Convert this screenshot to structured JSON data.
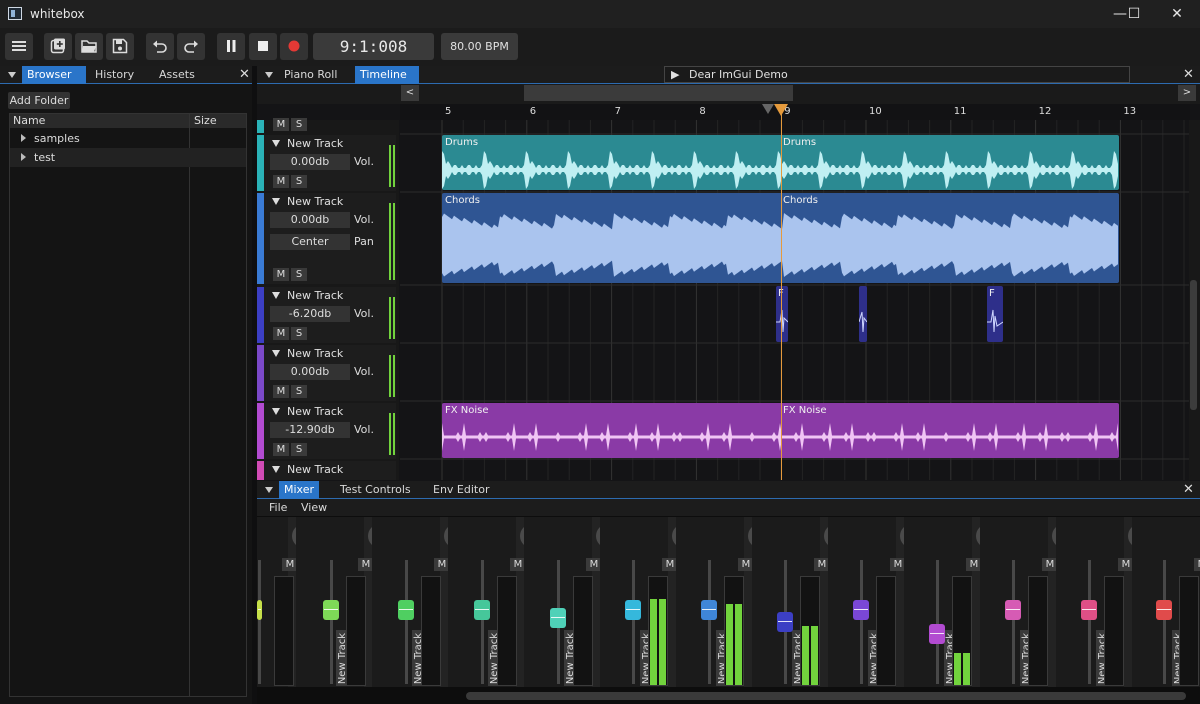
{
  "window": {
    "title": "whitebox",
    "minimize": "—",
    "maximize": "☐",
    "close": "✕"
  },
  "toolbar": {
    "buttons": [
      "menu-icon",
      "new-file-icon",
      "open-folder-icon",
      "save-icon",
      "undo-icon",
      "redo-icon",
      "pause-icon",
      "stop-icon",
      "record-icon"
    ],
    "time": "9:1:008",
    "bpm": "80.00 BPM"
  },
  "left_panel": {
    "tabs": [
      "Browser",
      "History",
      "Assets"
    ],
    "add_folder": "Add Folder",
    "columns": [
      "Name",
      "Size"
    ],
    "rows": [
      {
        "name": "samples"
      },
      {
        "name": "test"
      }
    ]
  },
  "center_tabs": [
    "Piano Roll",
    "Timeline"
  ],
  "imgui_window": {
    "title": "Dear ImGui Demo"
  },
  "timeline": {
    "nav_left": "<",
    "nav_right": ">",
    "bars": [
      "5",
      "6",
      "7",
      "8",
      "9",
      "10",
      "11",
      "12",
      "13"
    ],
    "tracks": [
      {
        "name": "New Track",
        "volume": "0.00db",
        "vol_label": "Vol.",
        "color": "#2bb3b8"
      },
      {
        "name": "New Track",
        "volume": "0.00db",
        "vol_label": "Vol.",
        "pan": "Center",
        "pan_label": "Pan",
        "color": "#3a7bd5"
      },
      {
        "name": "New Track",
        "volume": "-6.20db",
        "vol_label": "Vol.",
        "color": "#3c3fc4"
      },
      {
        "name": "New Track",
        "volume": "0.00db",
        "vol_label": "Vol.",
        "color": "#7b49c9"
      },
      {
        "name": "New Track",
        "volume": "-12.90db",
        "vol_label": "Vol.",
        "color": "#b24bd1"
      },
      {
        "name": "New Track",
        "color": "#d14bb5"
      }
    ],
    "mute_label": "M",
    "solo_label": "S",
    "clips": {
      "drums": [
        "Drums",
        "Drums"
      ],
      "chords": [
        "Chords",
        "Chords"
      ],
      "fx": [
        "FX Noise",
        "FX Noise"
      ],
      "short": [
        "F",
        "F"
      ]
    },
    "colors": {
      "drums": "#2b8a92",
      "chords": "#2f5593",
      "fx": "#8a3aa6",
      "short": "#2e2f8a",
      "playhead": "#e59a3c"
    }
  },
  "bottom_panel": {
    "tabs": [
      "Mixer",
      "Test Controls",
      "Env Editor"
    ],
    "menu": [
      "File",
      "View"
    ]
  },
  "mixer": {
    "strip_label": "New Track",
    "mute_label": "M",
    "solo_label": "S",
    "strips": [
      {
        "color": "#c6e04a",
        "level": 0.0
      },
      {
        "color": "#7ed957",
        "level": 0.0
      },
      {
        "color": "#4fcf61",
        "level": 0.0
      },
      {
        "color": "#46c79a",
        "level": 0.0
      },
      {
        "color": "#4fd1b8",
        "level": 0.0
      },
      {
        "color": "#35b8dc",
        "level": 0.8
      },
      {
        "color": "#3f86d8",
        "level": 0.75
      },
      {
        "color": "#3c3fc4",
        "level": 0.55
      },
      {
        "color": "#7a47d6",
        "level": 0.0
      },
      {
        "color": "#b24bd1",
        "level": 0.3
      },
      {
        "color": "#d65bb4",
        "level": 0.0
      },
      {
        "color": "#df4f86",
        "level": 0.0
      },
      {
        "color": "#e04b4b",
        "level": 0.0
      }
    ]
  }
}
